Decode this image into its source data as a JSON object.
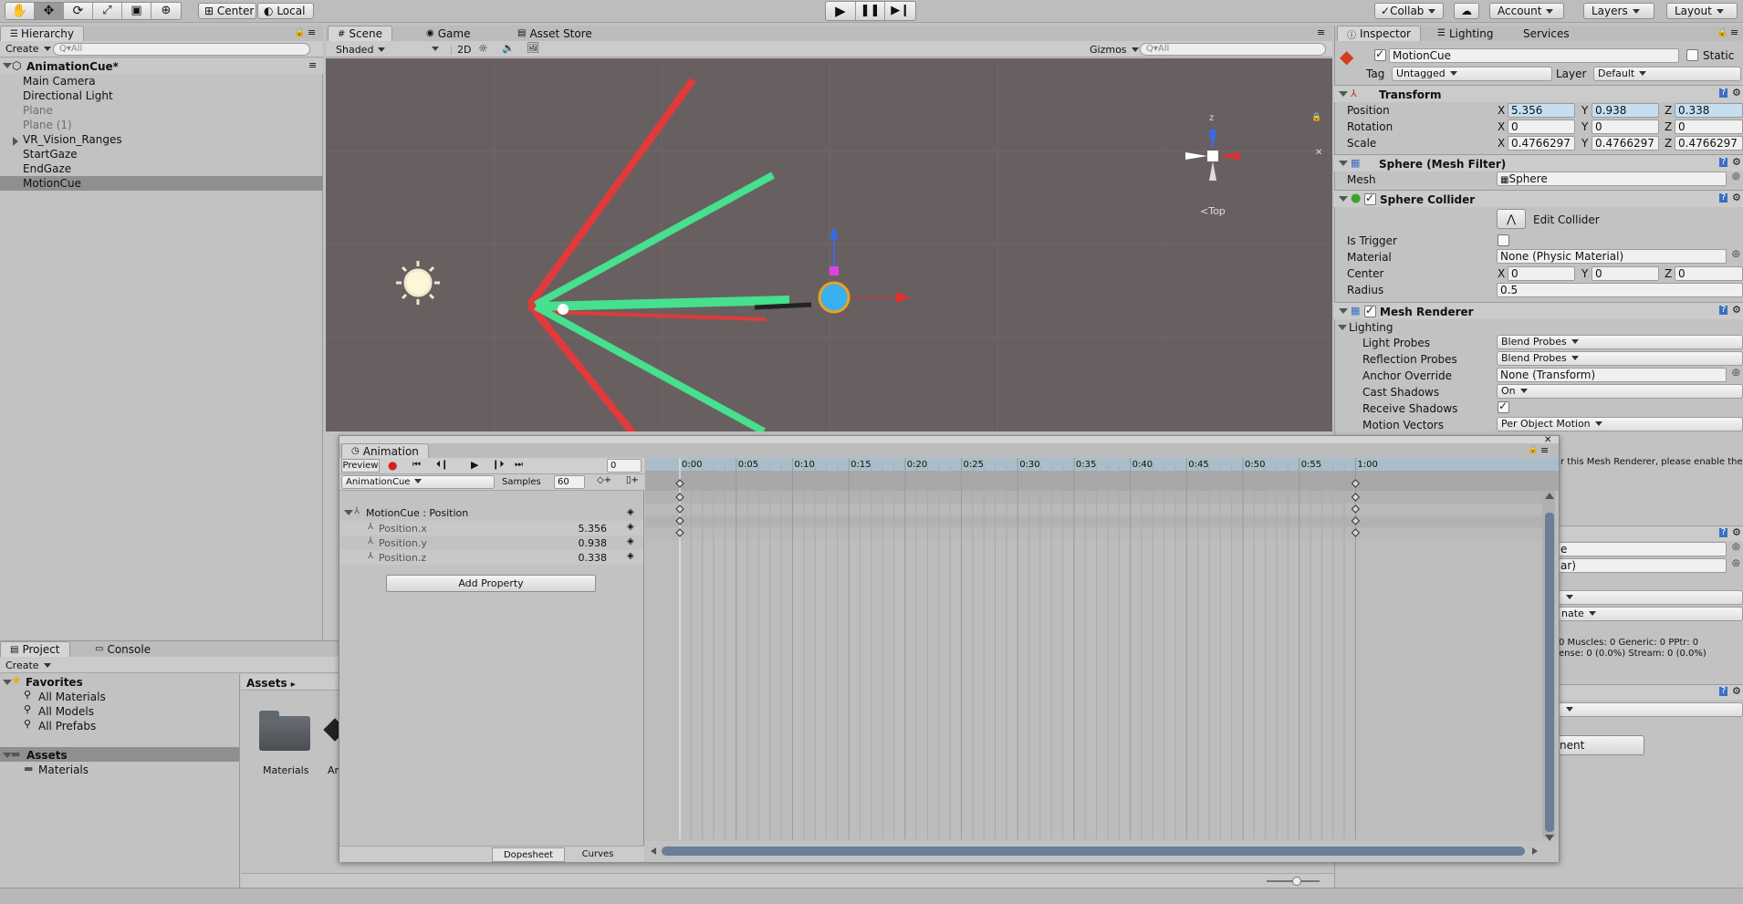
{
  "toolbar": {
    "tools": [
      "hand",
      "move",
      "rotate",
      "scale",
      "rect",
      "transform"
    ],
    "pivot": "Center",
    "space": "Local",
    "collab": "Collab",
    "account": "Account",
    "layers": "Layers",
    "layout": "Layout"
  },
  "hierarchy": {
    "tab": "Hierarchy",
    "create": "Create",
    "search_placeholder": "Q▾All",
    "scene": "AnimationCue*",
    "items": [
      {
        "label": "Main Camera",
        "state": "normal"
      },
      {
        "label": "Directional Light",
        "state": "normal"
      },
      {
        "label": "Plane",
        "state": "inactive"
      },
      {
        "label": "Plane (1)",
        "state": "inactive"
      },
      {
        "label": "VR_Vision_Ranges",
        "state": "collapsed"
      },
      {
        "label": "StartGaze",
        "state": "normal"
      },
      {
        "label": "EndGaze",
        "state": "normal"
      },
      {
        "label": "MotionCue",
        "state": "selected"
      }
    ]
  },
  "scene": {
    "tabs": [
      "Scene",
      "Game",
      "Asset Store"
    ],
    "shading": "Shaded",
    "mode2d": "2D",
    "gizmos": "Gizmos",
    "search_placeholder": "Q▾All",
    "view_label": "Top",
    "axis_z": "z"
  },
  "inspector": {
    "tabs": [
      "Inspector",
      "Lighting",
      "Services"
    ],
    "object_name": "MotionCue",
    "static_label": "Static",
    "tag_label": "Tag",
    "tag": "Untagged",
    "layer_label": "Layer",
    "layer": "Default",
    "transform": {
      "title": "Transform",
      "position": {
        "label": "Position",
        "x": "5.356",
        "y": "0.938",
        "z": "0.338"
      },
      "rotation": {
        "label": "Rotation",
        "x": "0",
        "y": "0",
        "z": "0"
      },
      "scale": {
        "label": "Scale",
        "x": "0.4766297",
        "y": "0.4766297",
        "z": "0.4766297"
      }
    },
    "mesh_filter": {
      "title": "Sphere (Mesh Filter)",
      "mesh_label": "Mesh",
      "mesh": "Sphere"
    },
    "sphere_collider": {
      "title": "Sphere Collider",
      "edit": "Edit Collider",
      "is_trigger": "Is Trigger",
      "material_label": "Material",
      "material": "None (Physic Material)",
      "center_label": "Center",
      "cx": "0",
      "cy": "0",
      "cz": "0",
      "radius_label": "Radius",
      "radius": "0.5"
    },
    "mesh_renderer": {
      "title": "Mesh Renderer",
      "lighting": "Lighting",
      "light_probes_label": "Light Probes",
      "light_probes": "Blend Probes",
      "reflection_probes_label": "Reflection Probes",
      "reflection_probes": "Blend Probes",
      "anchor_label": "Anchor Override",
      "anchor": "None (Transform)",
      "cast_label": "Cast Shadows",
      "cast": "On",
      "receive_label": "Receive Shadows",
      "motion_label": "Motion Vectors",
      "motion": "Per Object Motion"
    },
    "partial": {
      "warning": "r this Mesh Renderer, please enable the",
      "f1": "e",
      "f2": "ar)",
      "f3": "nate",
      "muscles": "0 Muscles: 0 Generic: 0 PPtr: 0",
      "stream": "ense: 0 (0.0%) Stream: 0 (0.0%)",
      "button": "nent"
    },
    "axes": {
      "x": "X",
      "y": "Y",
      "z": "Z"
    }
  },
  "project": {
    "tabs": [
      "Project",
      "Console"
    ],
    "create": "Create",
    "favorites": "Favorites",
    "fav_items": [
      "All Materials",
      "All Models",
      "All Prefabs"
    ],
    "assets": "Assets",
    "asset_items": [
      "Materials"
    ],
    "breadcrumb": "Assets",
    "grid": [
      {
        "label": "Materials"
      },
      {
        "label": "An"
      }
    ]
  },
  "animation": {
    "tab": "Animation",
    "preview": "Preview",
    "frame": "0",
    "clip": "AnimationCue",
    "samples_label": "Samples",
    "samples": "60",
    "property_group": "MotionCue : Position",
    "properties": [
      {
        "label": "Position.x",
        "value": "5.356"
      },
      {
        "label": "Position.y",
        "value": "0.938"
      },
      {
        "label": "Position.z",
        "value": "0.338"
      }
    ],
    "add_property": "Add Property",
    "timeline": [
      "0:00",
      "0:05",
      "0:10",
      "0:15",
      "0:20",
      "0:25",
      "0:30",
      "0:35",
      "0:40",
      "0:45",
      "0:50",
      "0:55",
      "1:00"
    ],
    "keyframe_times": [
      "0:00",
      "1:00"
    ],
    "dopesheet": "Dopesheet",
    "curves": "Curves"
  }
}
